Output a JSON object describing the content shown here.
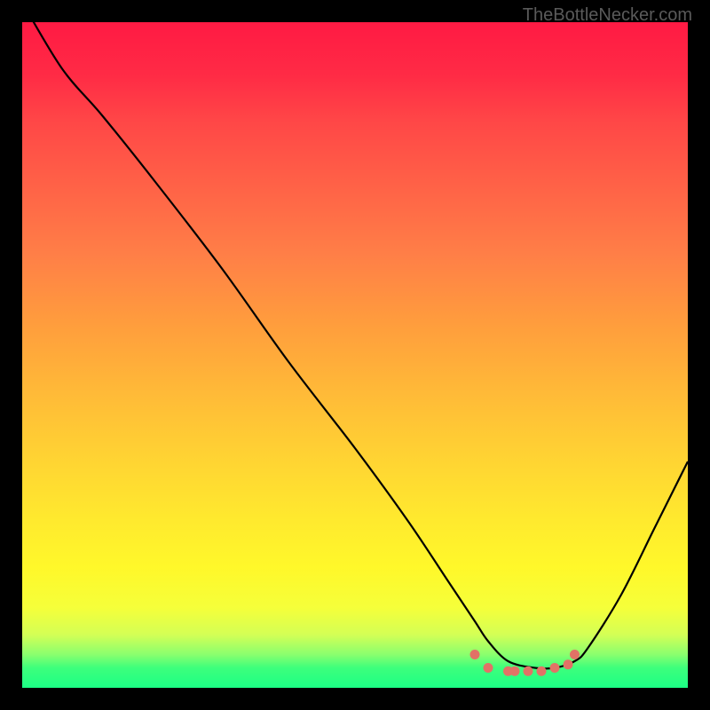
{
  "watermark": "TheBottleNecker.com",
  "chart_data": {
    "type": "line",
    "title": "",
    "xlabel": "",
    "ylabel": "",
    "xlim": [
      0,
      100
    ],
    "ylim": [
      0,
      100
    ],
    "series": [
      {
        "name": "bottleneck-curve",
        "x": [
          0,
          6,
          12,
          20,
          30,
          40,
          50,
          58,
          64,
          68,
          70,
          73,
          77,
          80,
          83,
          85,
          90,
          95,
          100
        ],
        "values": [
          103,
          93,
          86,
          76,
          63,
          49,
          36,
          25,
          16,
          10,
          7,
          4,
          3,
          3,
          4,
          6,
          14,
          24,
          34
        ]
      }
    ],
    "markers": {
      "name": "sweet-spot-dots",
      "color": "#e27266",
      "points": [
        {
          "x": 68,
          "y": 5
        },
        {
          "x": 70,
          "y": 3
        },
        {
          "x": 73,
          "y": 2.5
        },
        {
          "x": 74,
          "y": 2.5
        },
        {
          "x": 76,
          "y": 2.5
        },
        {
          "x": 78,
          "y": 2.5
        },
        {
          "x": 80,
          "y": 3
        },
        {
          "x": 82,
          "y": 3.5
        },
        {
          "x": 83,
          "y": 5
        }
      ]
    }
  }
}
